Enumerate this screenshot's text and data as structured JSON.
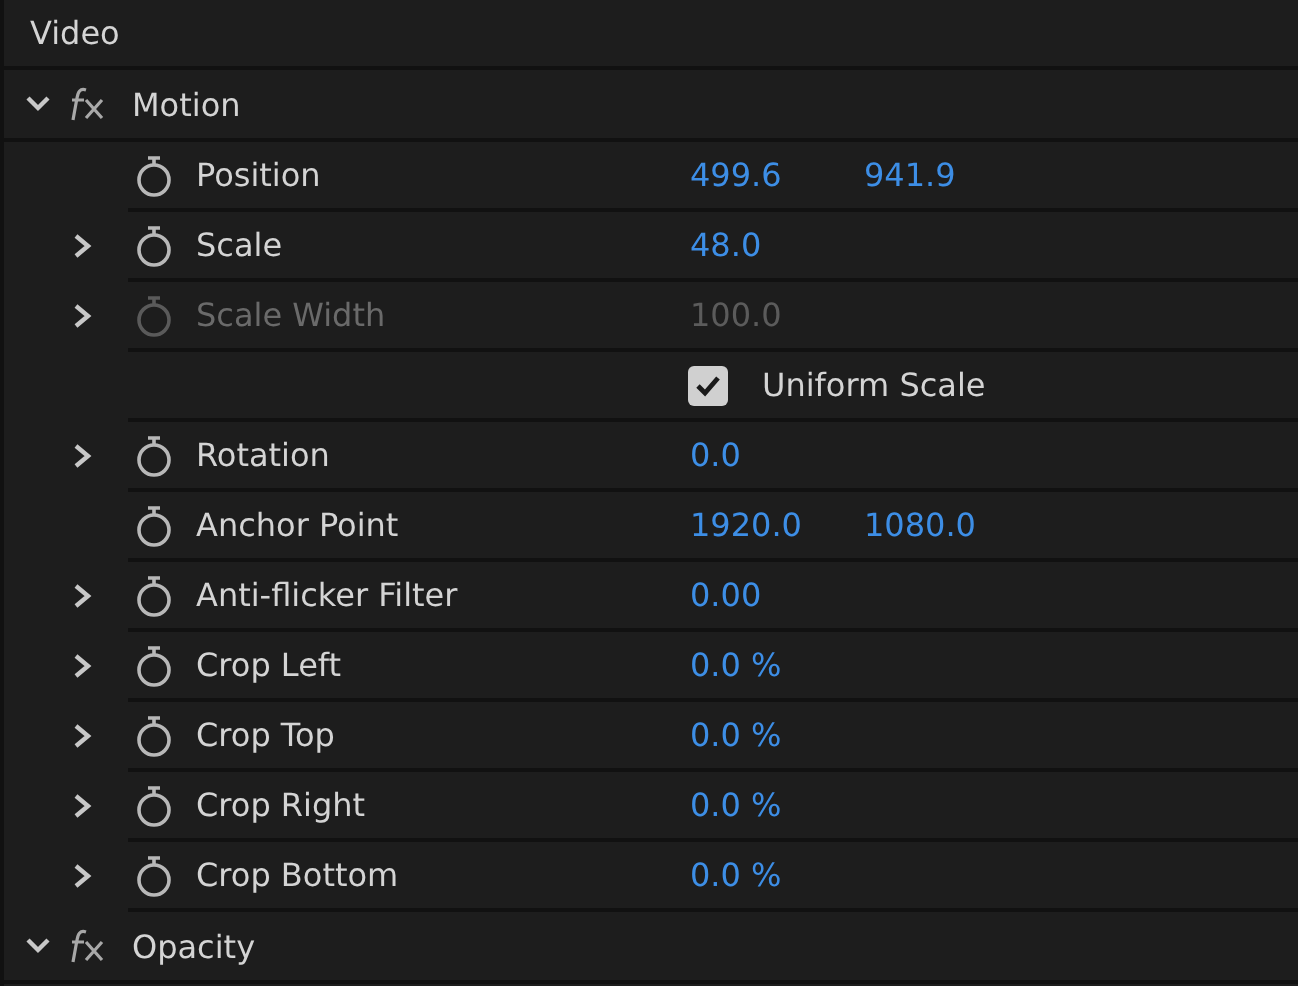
{
  "section": {
    "title": "Video"
  },
  "effects": [
    {
      "name": "Motion",
      "expanded": true,
      "properties": [
        {
          "kind": "param",
          "label": "Position",
          "expandable": false,
          "disabled": false,
          "values": [
            "499.6",
            "941.9"
          ]
        },
        {
          "kind": "param",
          "label": "Scale",
          "expandable": true,
          "disabled": false,
          "values": [
            "48.0"
          ]
        },
        {
          "kind": "param",
          "label": "Scale Width",
          "expandable": true,
          "disabled": true,
          "values": [
            "100.0"
          ]
        },
        {
          "kind": "checkbox",
          "label": "Uniform Scale",
          "checked": true
        },
        {
          "kind": "param",
          "label": "Rotation",
          "expandable": true,
          "disabled": false,
          "values": [
            "0.0"
          ]
        },
        {
          "kind": "param",
          "label": "Anchor Point",
          "expandable": false,
          "disabled": false,
          "values": [
            "1920.0",
            "1080.0"
          ]
        },
        {
          "kind": "param",
          "label": "Anti-flicker Filter",
          "expandable": true,
          "disabled": false,
          "values": [
            "0.00"
          ]
        },
        {
          "kind": "param",
          "label": "Crop Left",
          "expandable": true,
          "disabled": false,
          "values": [
            "0.0 %"
          ]
        },
        {
          "kind": "param",
          "label": "Crop Top",
          "expandable": true,
          "disabled": false,
          "values": [
            "0.0 %"
          ]
        },
        {
          "kind": "param",
          "label": "Crop Right",
          "expandable": true,
          "disabled": false,
          "values": [
            "0.0 %"
          ]
        },
        {
          "kind": "param",
          "label": "Crop Bottom",
          "expandable": true,
          "disabled": false,
          "values": [
            "0.0 %"
          ]
        }
      ]
    },
    {
      "name": "Opacity",
      "expanded": true
    }
  ]
}
